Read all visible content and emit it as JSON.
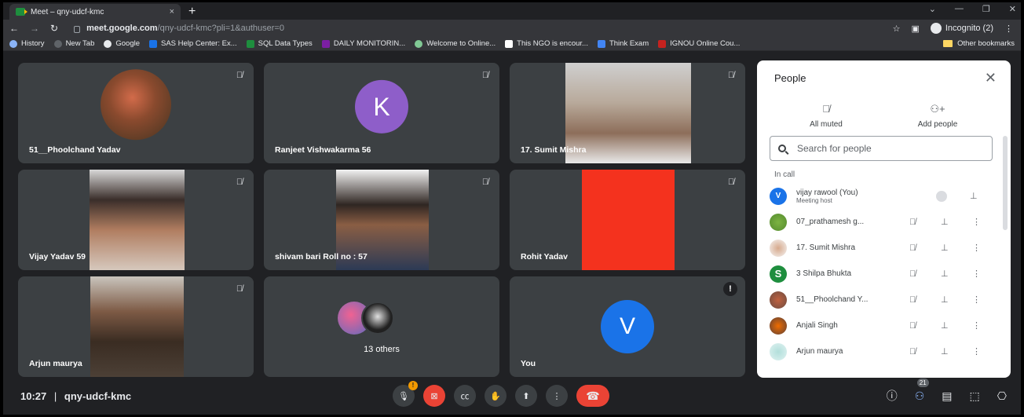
{
  "browser": {
    "tab_title": "Meet – qny-udcf-kmc",
    "tab_close": "×",
    "new_tab": "+",
    "url_host": "meet.google.com",
    "url_path": "/qny-udcf-kmc?pli=1&authuser=0",
    "incognito_label": "Incognito (2)",
    "bookmarks": [
      "History",
      "New Tab",
      "Google",
      "SAS Help Center: Ex...",
      "SQL Data Types",
      "DAILY MONITORIN...",
      "Welcome to Online...",
      "This NGO is encour...",
      "Think Exam",
      "IGNOU Online Cou..."
    ],
    "other_bookmarks": "Other bookmarks"
  },
  "tiles": [
    {
      "name": "51__Phoolchand Yadav"
    },
    {
      "name": "Ranjeet Vishwakarma 56",
      "initial": "K"
    },
    {
      "name": "17. Sumit Mishra"
    },
    {
      "name": "Vijay Yadav 59"
    },
    {
      "name": "shivam bari Roll no : 57"
    },
    {
      "name": "Rohit Yadav"
    },
    {
      "name": "Arjun maurya"
    },
    {
      "name": "13 others"
    },
    {
      "name": "You",
      "initial": "V"
    }
  ],
  "controls": {
    "time": "10:27",
    "separator": "|",
    "meeting_code": "qny-udcf-kmc",
    "people_count": "21",
    "mic_badge": "!"
  },
  "people_panel": {
    "title": "People",
    "all_muted": "All muted",
    "add_people": "Add people",
    "search_placeholder": "Search for people",
    "in_call": "In call",
    "participants": [
      {
        "name": "vijay rawool (You)",
        "sub": "Meeting host",
        "initial": "V"
      },
      {
        "name": "07_prathamesh g..."
      },
      {
        "name": "17. Sumit Mishra"
      },
      {
        "name": "3 Shilpa Bhukta",
        "initial": "S"
      },
      {
        "name": "51__Phoolchand Y..."
      },
      {
        "name": "Anjali Singh"
      },
      {
        "name": "Arjun maurya"
      }
    ]
  },
  "colors": {
    "stage_bg": "#202124",
    "tile_bg": "#3c4043",
    "purple_avatar": "#8e5ec9",
    "blue_avatar": "#1a73e8",
    "hangup_red": "#ea4335",
    "green_avatar": "#1e8e3e"
  }
}
